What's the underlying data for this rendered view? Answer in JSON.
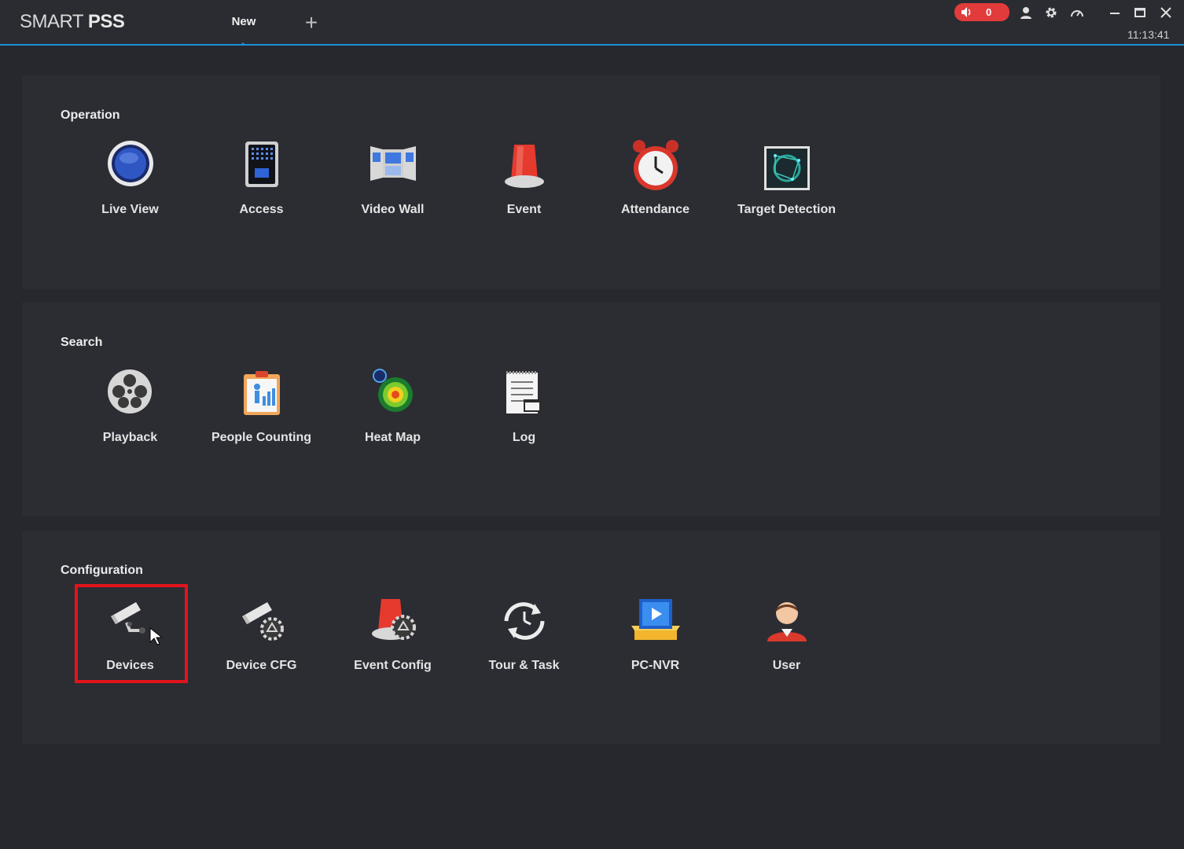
{
  "app": {
    "title_light": "SMART ",
    "title_bold": "PSS"
  },
  "tabs": {
    "active": "New",
    "add_symbol": "+"
  },
  "titlebar": {
    "alarm_count": "0",
    "time": "11:13:41"
  },
  "sections": [
    {
      "title": "Operation",
      "items": [
        {
          "label": "Live View",
          "icon": "live-view-icon"
        },
        {
          "label": "Access",
          "icon": "access-icon"
        },
        {
          "label": "Video Wall",
          "icon": "video-wall-icon"
        },
        {
          "label": "Event",
          "icon": "event-icon"
        },
        {
          "label": "Attendance",
          "icon": "attendance-icon"
        },
        {
          "label": "Target Detection",
          "icon": "target-detection-icon"
        }
      ]
    },
    {
      "title": "Search",
      "items": [
        {
          "label": "Playback",
          "icon": "playback-icon"
        },
        {
          "label": "People Counting",
          "icon": "people-counting-icon"
        },
        {
          "label": "Heat Map",
          "icon": "heat-map-icon"
        },
        {
          "label": "Log",
          "icon": "log-icon"
        }
      ]
    },
    {
      "title": "Configuration",
      "items": [
        {
          "label": "Devices",
          "icon": "devices-icon"
        },
        {
          "label": "Device CFG",
          "icon": "device-cfg-icon"
        },
        {
          "label": "Event Config",
          "icon": "event-config-icon"
        },
        {
          "label": "Tour & Task",
          "icon": "tour-task-icon"
        },
        {
          "label": "PC-NVR",
          "icon": "pc-nvr-icon"
        },
        {
          "label": "User",
          "icon": "user-icon"
        }
      ]
    }
  ],
  "colors": {
    "accent": "#1e8fd6",
    "alarm": "#e23b3b",
    "highlight": "#e3131b"
  }
}
